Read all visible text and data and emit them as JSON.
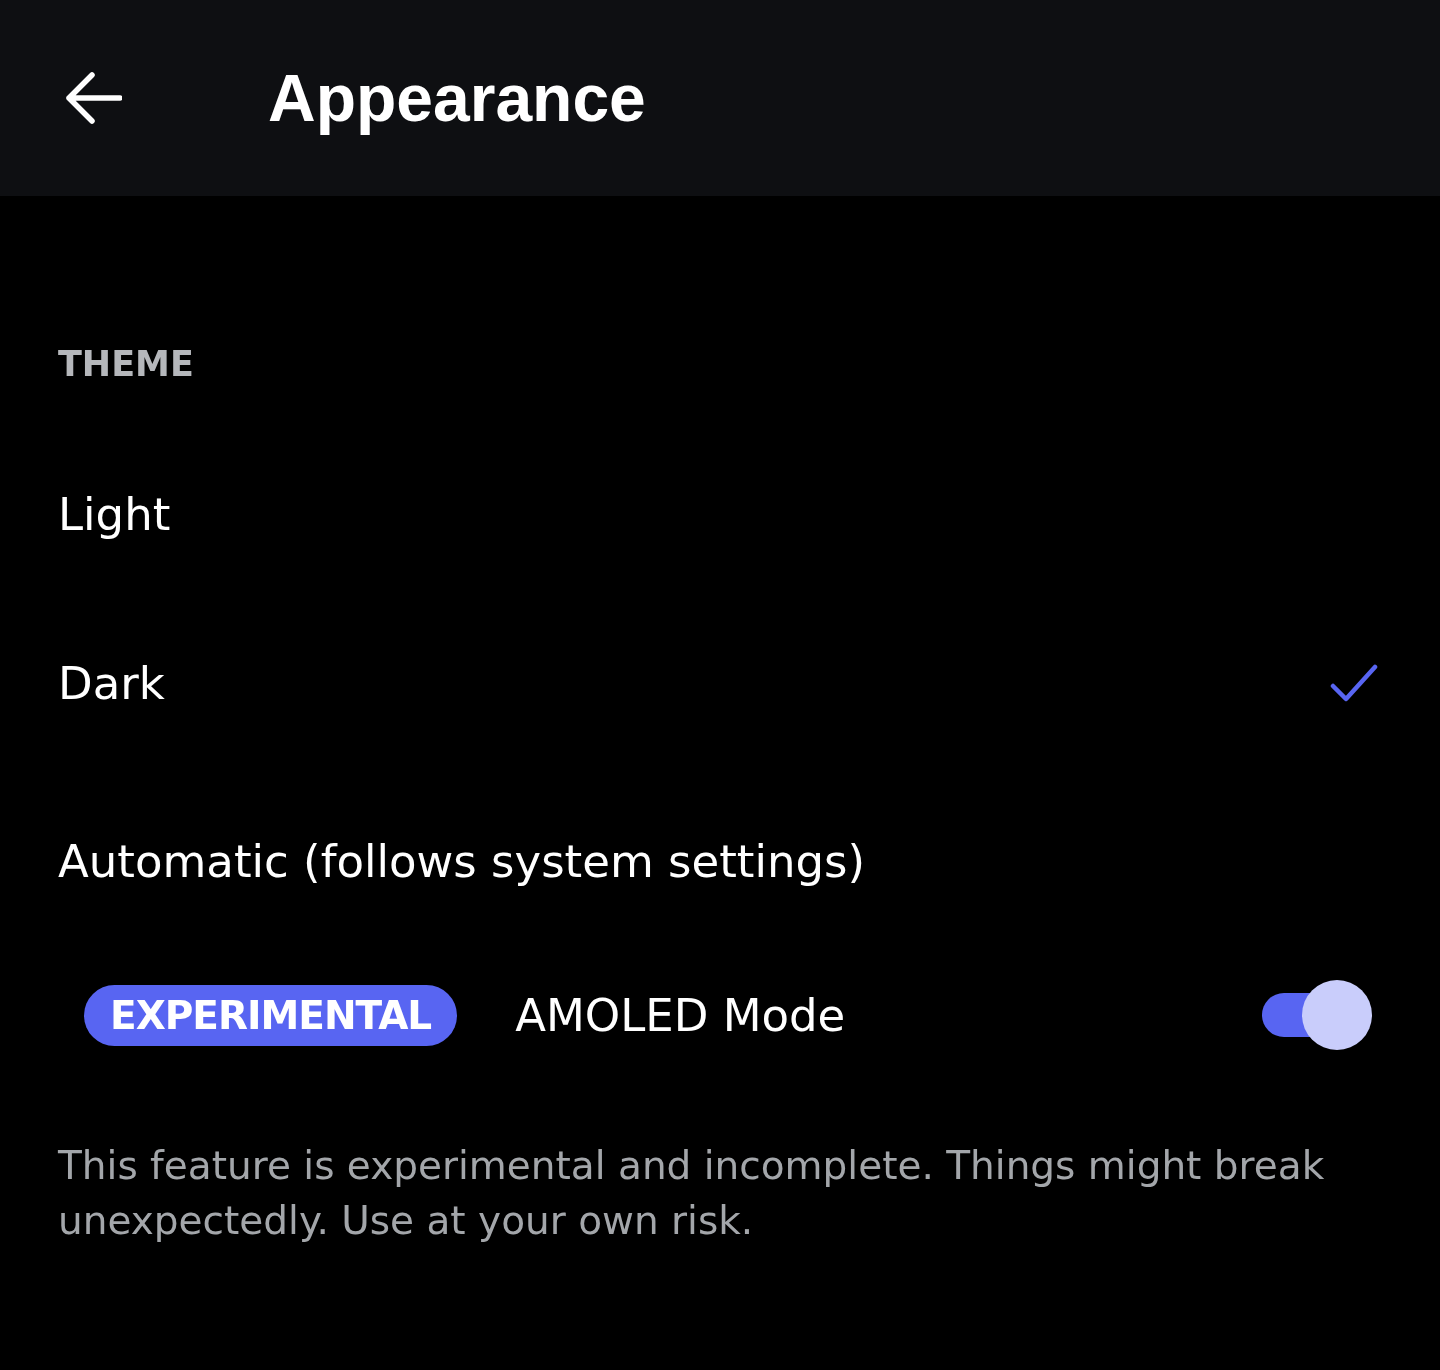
{
  "header": {
    "title": "Appearance"
  },
  "theme": {
    "label": "THEME",
    "options": [
      {
        "label": "Light",
        "selected": false
      },
      {
        "label": "Dark",
        "selected": true
      },
      {
        "label": "Automatic (follows system settings)",
        "selected": false
      }
    ]
  },
  "amoled": {
    "badge": "EXPERIMENTAL",
    "label": "AMOLED Mode",
    "on": true
  },
  "description": "This feature is experimental and incomplete. Things might break unexpectedly. Use at your own risk."
}
